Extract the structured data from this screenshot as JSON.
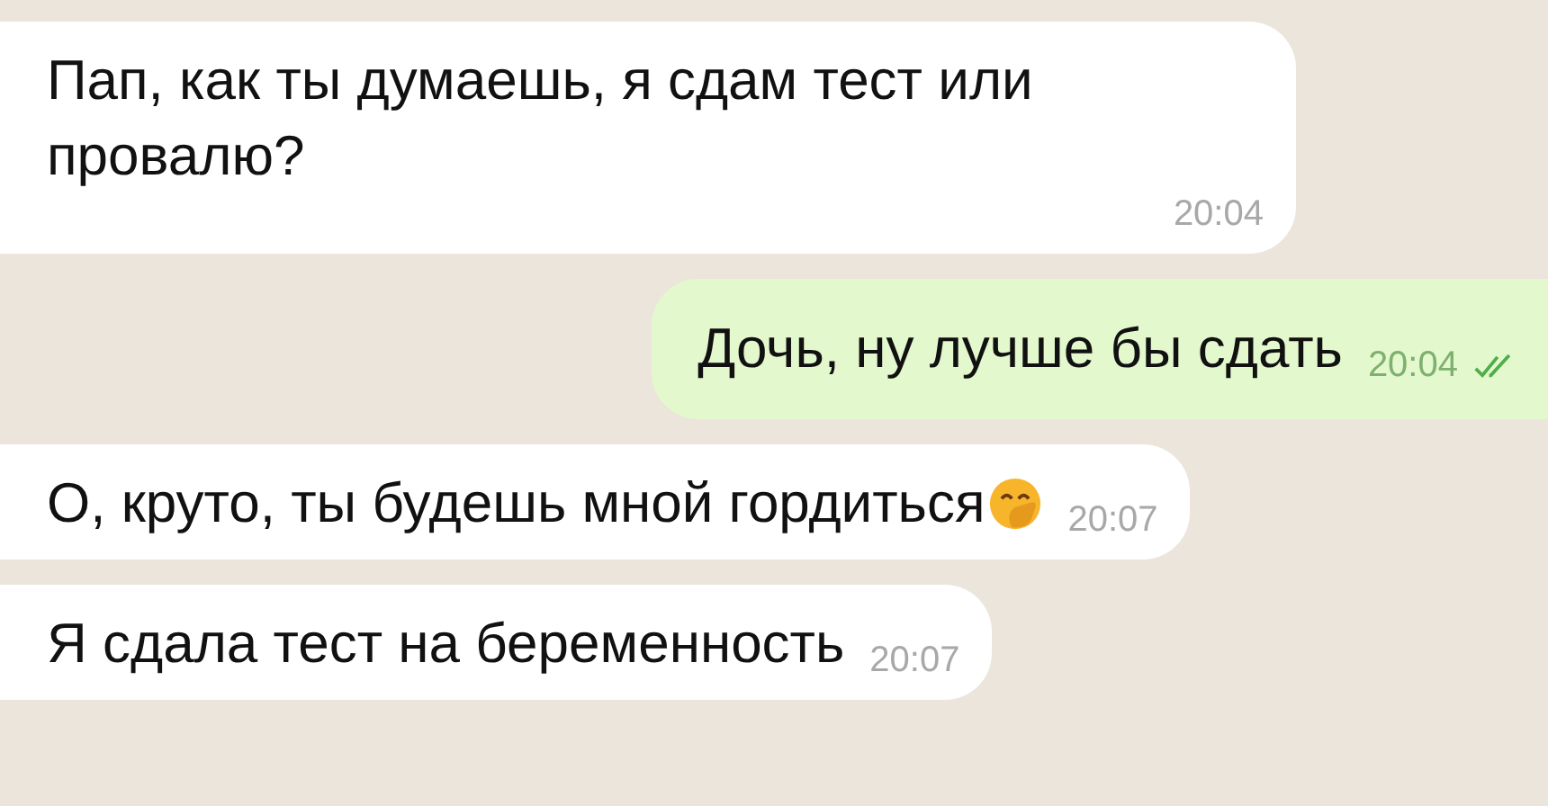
{
  "messages": [
    {
      "kind": "incoming",
      "text": "Пап, как ты думаешь, я сдам тест или провалю?",
      "time": "20:04",
      "emoji": false
    },
    {
      "kind": "outgoing",
      "text": "Дочь, ну лучше бы сдать",
      "time": "20:04",
      "read": true,
      "emoji": false
    },
    {
      "kind": "incoming",
      "text": "О, круто, ты будешь мной гордиться",
      "time": "20:07",
      "emoji": true
    },
    {
      "kind": "incoming",
      "text": "Я сдала тест на беременность",
      "time": "20:07",
      "emoji": false
    }
  ]
}
